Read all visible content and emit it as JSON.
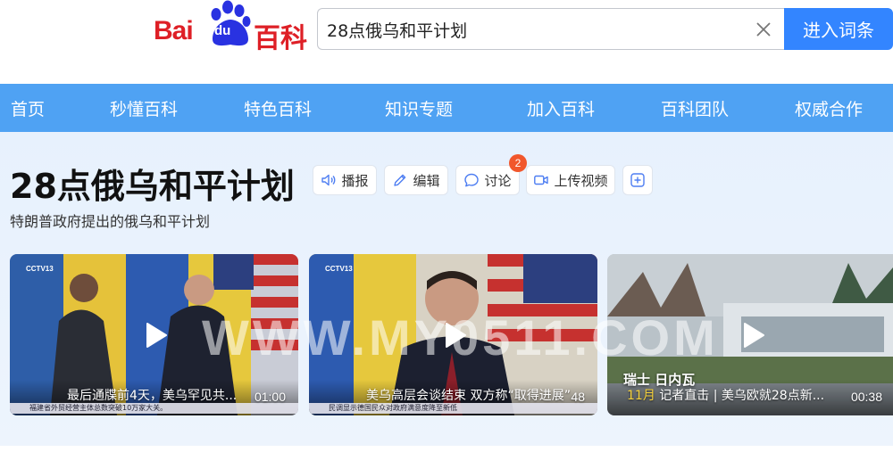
{
  "logo": {
    "bai": "Bai",
    "du": "du",
    "baike": "百科"
  },
  "search": {
    "value": "28点俄乌和平计划",
    "button_label": "进入词条"
  },
  "nav": [
    "首页",
    "秒懂百科",
    "特色百科",
    "知识专题",
    "加入百科",
    "百科团队",
    "权威合作"
  ],
  "entry": {
    "title": "28点俄乌和平计划",
    "subtitle": "特朗普政府提出的俄乌和平计划"
  },
  "tools": {
    "play": "播报",
    "edit": "编辑",
    "discuss": "讨论",
    "discuss_badge": "2",
    "upload": "上传视频"
  },
  "videos": [
    {
      "title": "最后通牒前4天，美乌罕见共...",
      "duration": "01:00",
      "channel": "CCTV13",
      "ticker": "福建省外贸经营主体总数突破10万家大关。"
    },
    {
      "title": "美乌高层会谈结束 双方称“取得进展”",
      "duration": "00:48",
      "channel": "CCTV13",
      "ticker": "民调显示德国民众对政府满意度降至新低"
    },
    {
      "title": "记者直击 | 美乌欧就28点新...",
      "duration": "00:38",
      "location": "瑞士  日内瓦",
      "date": "11月"
    }
  ],
  "watermark": "WWW.MY0511.COM",
  "colors": {
    "nav": "#4fa2f3",
    "search_button": "#3385ff",
    "logo_red": "#de1f26",
    "logo_blue": "#2932e1",
    "badge": "#f1572c"
  }
}
